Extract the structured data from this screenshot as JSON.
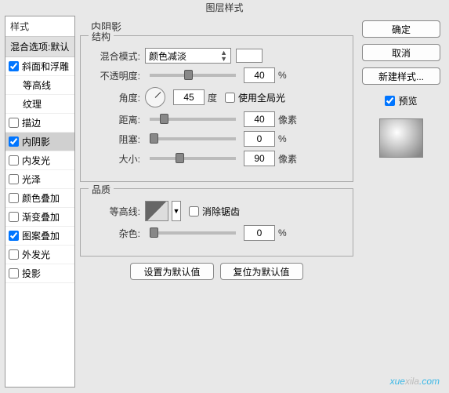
{
  "title": "图层样式",
  "styles_header": "样式",
  "blend_options": "混合选项:默认",
  "effects": [
    {
      "key": "bevel",
      "label": "斜面和浮雕",
      "checked": true
    },
    {
      "key": "contour_sub",
      "label": "等高线",
      "checked": false,
      "indent": true
    },
    {
      "key": "texture_sub",
      "label": "纹理",
      "checked": false,
      "indent": true
    },
    {
      "key": "stroke",
      "label": "描边",
      "checked": false
    },
    {
      "key": "inner_shadow",
      "label": "内阴影",
      "checked": true,
      "selected": true
    },
    {
      "key": "inner_glow",
      "label": "内发光",
      "checked": false
    },
    {
      "key": "satin",
      "label": "光泽",
      "checked": false
    },
    {
      "key": "color_overlay",
      "label": "颜色叠加",
      "checked": false
    },
    {
      "key": "gradient_overlay",
      "label": "渐变叠加",
      "checked": false
    },
    {
      "key": "pattern_overlay",
      "label": "图案叠加",
      "checked": true
    },
    {
      "key": "outer_glow",
      "label": "外发光",
      "checked": false
    },
    {
      "key": "drop_shadow",
      "label": "投影",
      "checked": false
    }
  ],
  "panel_title": "内阴影",
  "structure": {
    "legend": "结构",
    "blend_mode_label": "混合模式:",
    "blend_mode_value": "颜色减淡",
    "opacity_label": "不透明度:",
    "opacity_value": "40",
    "opacity_unit": "%",
    "angle_label": "角度:",
    "angle_value": "45",
    "angle_unit": "度",
    "global_light_label": "使用全局光",
    "distance_label": "距离:",
    "distance_value": "40",
    "distance_unit": "像素",
    "choke_label": "阻塞:",
    "choke_value": "0",
    "choke_unit": "%",
    "size_label": "大小:",
    "size_value": "90",
    "size_unit": "像素"
  },
  "quality": {
    "legend": "品质",
    "contour_label": "等高线:",
    "antialias_label": "消除锯齿",
    "noise_label": "杂色:",
    "noise_value": "0",
    "noise_unit": "%"
  },
  "btn_default": "设置为默认值",
  "btn_reset": "复位为默认值",
  "right": {
    "ok": "确定",
    "cancel": "取消",
    "new_style": "新建样式...",
    "preview": "预览"
  },
  "watermark_a": "xue",
  "watermark_b": "xila",
  "watermark_c": ".com"
}
